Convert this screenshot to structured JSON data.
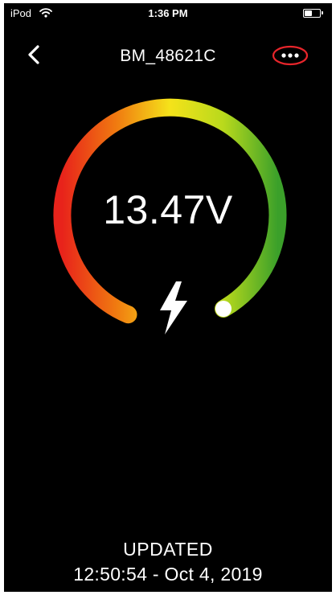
{
  "status_bar": {
    "carrier": "iPod",
    "time": "1:36 PM",
    "battery_level": 0.5,
    "wifi_icon": "wifi-icon",
    "battery_icon": "battery-icon"
  },
  "nav": {
    "title": "BM_48621C",
    "back_icon": "chevron-left-icon",
    "more_icon": "ellipsis-icon",
    "more_highlight_color": "#e8252b"
  },
  "gauge": {
    "voltage": "13.47V",
    "level": 1.0,
    "charging_icon": "lightning-bolt-icon",
    "gradient_colors": [
      "#e8231b",
      "#f07a10",
      "#f5e31a",
      "#b8d91c",
      "#3ba02a"
    ]
  },
  "footer": {
    "updated_label": "UPDATED",
    "updated_time": "12:50:54 - Oct 4, 2019"
  }
}
